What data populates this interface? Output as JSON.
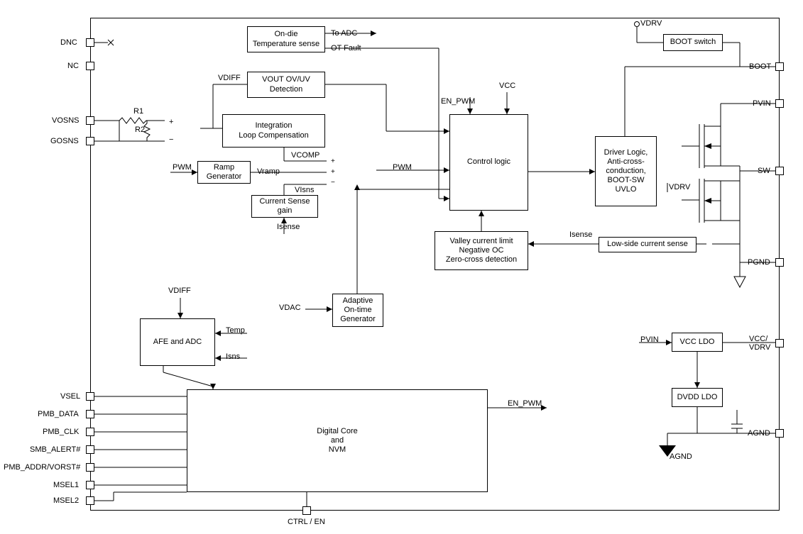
{
  "pins_left": {
    "dnc": "DNC",
    "nc": "NC",
    "vosns": "VOSNS",
    "gosns": "GOSNS",
    "vsel": "VSEL",
    "pmb_data": "PMB_DATA",
    "pmb_clk": "PMB_CLK",
    "smb_alert": "SMB_ALERT#",
    "pmb_addr": "PMB_ADDR/VORST#",
    "msel1": "MSEL1",
    "msel2": "MSEL2"
  },
  "pins_right": {
    "boot": "BOOT",
    "pvin": "PVIN",
    "sw": "SW",
    "pgnd": "PGND",
    "vcc_vdrv": "VCC/\nVDRV",
    "agnd": "AGND"
  },
  "pins_bottom": {
    "ctrl_en": "CTRL / EN"
  },
  "pins_top": {
    "vdrv": "VDRV"
  },
  "blocks": {
    "temp_sense": "On-die\nTemperature sense",
    "vout_detect": "VOUT OV/UV\nDetection",
    "integration": "Integration\nLoop Compensation",
    "ramp_gen": "Ramp\nGenerator",
    "current_sense_gain": "Current Sense\ngain",
    "control_logic": "Control logic",
    "driver_logic": "Driver Logic,\nAnti-cross-\nconduction,\nBOOT-SW\nUVLO",
    "boot_switch": "BOOT switch",
    "valley": "Valley current limit\nNegative OC\nZero-cross detection",
    "lowside_cs": "Low-side current sense",
    "adaptive": "Adaptive\nOn-time\nGenerator",
    "afe_adc": "AFE and ADC",
    "digital_core": "Digital Core\nand\nNVM",
    "vcc_ldo": "VCC LDO",
    "dvdd_ldo": "DVDD LDO"
  },
  "signals": {
    "to_adc": "To ADC",
    "ot_fault": "OT Fault",
    "vdiff": "VDIFF",
    "vcomp": "VCOMP",
    "pwm": "PWM",
    "vramp": "Vramp",
    "visns": "VIsns",
    "isense": "Isense",
    "isense2": "Isense",
    "en_pwm": "EN_PWM",
    "en_pwm2": "EN_PWM",
    "vcc": "VCC",
    "vdrv2": "VDRV",
    "vdac": "VDAC",
    "vdiff2": "VDIFF",
    "temp": "Temp",
    "isns": "Isns",
    "pvin2": "PVIN",
    "agnd2": "AGND",
    "r1": "R1",
    "r2": "R2"
  }
}
